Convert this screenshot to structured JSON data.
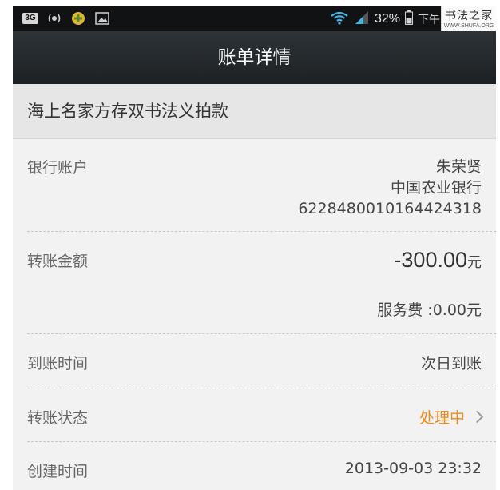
{
  "statusbar": {
    "badge": "3G",
    "battery_pct": "32%",
    "time_partial": "下午"
  },
  "watermark": {
    "logo": "书法之家",
    "url": "WWW.SHUFA.ORG"
  },
  "titlebar": {
    "title": "账单详情"
  },
  "merchant": {
    "name": "海上名家方存双书法义拍款"
  },
  "rows": {
    "bank": {
      "label": "银行账户",
      "name": "朱荣贤",
      "bank": "中国农业银行",
      "account": "6228480010164424318"
    },
    "amount": {
      "label": "转账金额",
      "value": "-300.00",
      "unit": "元",
      "fee": "服务费 :0.00元"
    },
    "arrival": {
      "label": "到账时间",
      "value": "次日到账"
    },
    "status": {
      "label": "转账状态",
      "value": "处理中"
    },
    "created": {
      "label": "创建时间",
      "value": "2013-09-03 23:32"
    }
  },
  "colors": {
    "status": "#ef8a1c",
    "titlebar": "#24292c",
    "background": "#f2f2f2"
  }
}
